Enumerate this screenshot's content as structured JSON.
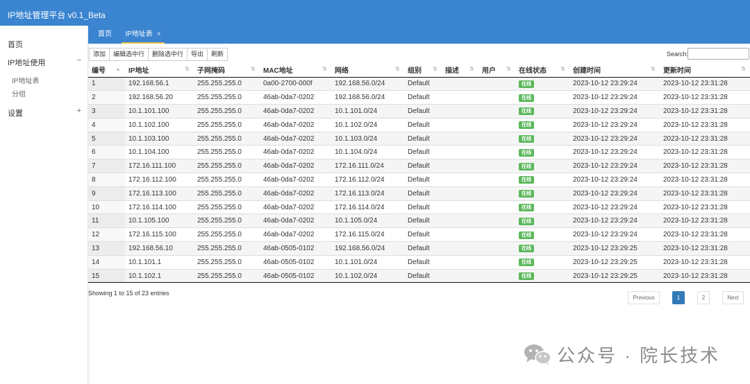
{
  "app": {
    "title": "IP地址管理平台 v0.1_Beta"
  },
  "sidebar": {
    "home": "首页",
    "ip_usage": "IP地址使用",
    "ip_usage_toggle": "−",
    "sub_items": [
      "IP地址表",
      "分组"
    ],
    "settings": "设置",
    "settings_toggle": "+"
  },
  "tabs": [
    {
      "label": "首页"
    },
    {
      "label": "IP地址表",
      "close": "×"
    }
  ],
  "toolbar": {
    "add": "添加",
    "edit": "编辑选中行",
    "delete": "删除选中行",
    "export": "导出",
    "refresh": "刷新"
  },
  "search": {
    "label": "Search:",
    "value": ""
  },
  "table": {
    "headers": [
      "编号",
      "IP地址",
      "子网掩码",
      "MAC地址",
      "网络",
      "组别",
      "描述",
      "用户",
      "在线状态",
      "创建时间",
      "更新时间"
    ],
    "rows": [
      [
        "1",
        "192.168.56.1",
        "255.255.255.0",
        "0a00-2700-000f",
        "192.168.56.0/24",
        "Default",
        "",
        "",
        "在线",
        "2023-10-12 23:29:24",
        "2023-10-12 23:31:28"
      ],
      [
        "2",
        "192.168.56.20",
        "255.255.255.0",
        "46ab-0da7-0202",
        "192.168.56.0/24",
        "Default",
        "",
        "",
        "在线",
        "2023-10-12 23:29:24",
        "2023-10-12 23:31:28"
      ],
      [
        "3",
        "10.1.101.100",
        "255.255.255.0",
        "46ab-0da7-0202",
        "10.1.101.0/24",
        "Default",
        "",
        "",
        "在线",
        "2023-10-12 23:29:24",
        "2023-10-12 23:31:28"
      ],
      [
        "4",
        "10.1.102.100",
        "255.255.255.0",
        "46ab-0da7-0202",
        "10.1.102.0/24",
        "Default",
        "",
        "",
        "在线",
        "2023-10-12 23:29:24",
        "2023-10-12 23:31:28"
      ],
      [
        "5",
        "10.1.103.100",
        "255.255.255.0",
        "46ab-0da7-0202",
        "10.1.103.0/24",
        "Default",
        "",
        "",
        "在线",
        "2023-10-12 23:29:24",
        "2023-10-12 23:31:28"
      ],
      [
        "6",
        "10.1.104.100",
        "255.255.255.0",
        "46ab-0da7-0202",
        "10.1.104.0/24",
        "Default",
        "",
        "",
        "在线",
        "2023-10-12 23:29:24",
        "2023-10-12 23:31:28"
      ],
      [
        "7",
        "172.16.111.100",
        "255.255.255.0",
        "46ab-0da7-0202",
        "172.16.111.0/24",
        "Default",
        "",
        "",
        "在线",
        "2023-10-12 23:29:24",
        "2023-10-12 23:31:28"
      ],
      [
        "8",
        "172.16.112.100",
        "255.255.255.0",
        "46ab-0da7-0202",
        "172.16.112.0/24",
        "Default",
        "",
        "",
        "在线",
        "2023-10-12 23:29:24",
        "2023-10-12 23:31:28"
      ],
      [
        "9",
        "172.16.113.100",
        "255.255.255.0",
        "46ab-0da7-0202",
        "172.16.113.0/24",
        "Default",
        "",
        "",
        "在线",
        "2023-10-12 23:29:24",
        "2023-10-12 23:31:28"
      ],
      [
        "10",
        "172.16.114.100",
        "255.255.255.0",
        "46ab-0da7-0202",
        "172.16.114.0/24",
        "Default",
        "",
        "",
        "在线",
        "2023-10-12 23:29:24",
        "2023-10-12 23:31:28"
      ],
      [
        "11",
        "10.1.105.100",
        "255.255.255.0",
        "46ab-0da7-0202",
        "10.1.105.0/24",
        "Default",
        "",
        "",
        "在线",
        "2023-10-12 23:29:24",
        "2023-10-12 23:31:28"
      ],
      [
        "12",
        "172.16.115.100",
        "255.255.255.0",
        "46ab-0da7-0202",
        "172.16.115.0/24",
        "Default",
        "",
        "",
        "在线",
        "2023-10-12 23:29:24",
        "2023-10-12 23:31:28"
      ],
      [
        "13",
        "192.168.56.10",
        "255.255.255.0",
        "46ab-0505-0102",
        "192.168.56.0/24",
        "Default",
        "",
        "",
        "在线",
        "2023-10-12 23:29:25",
        "2023-10-12 23:31:28"
      ],
      [
        "14",
        "10.1.101.1",
        "255.255.255.0",
        "46ab-0505-0102",
        "10.1.101.0/24",
        "Default",
        "",
        "",
        "在线",
        "2023-10-12 23:29:25",
        "2023-10-12 23:31:28"
      ],
      [
        "15",
        "10.1.102.1",
        "255.255.255.0",
        "46ab-0505-0102",
        "10.1.102.0/24",
        "Default",
        "",
        "",
        "在线",
        "2023-10-12 23:29:25",
        "2023-10-12 23:31:28"
      ]
    ]
  },
  "footer": {
    "info": "Showing 1 to 15 of 23 entries",
    "previous": "Previous",
    "pages": [
      "1",
      "2"
    ],
    "current_page": "1",
    "next": "Next"
  },
  "watermark": {
    "text": "公众号 · 院长技术"
  },
  "colors": {
    "brand": "#3a84d0",
    "tab_underline": "#f0c44a",
    "online_badge": "#5cb85c",
    "page_active": "#337ab7"
  }
}
